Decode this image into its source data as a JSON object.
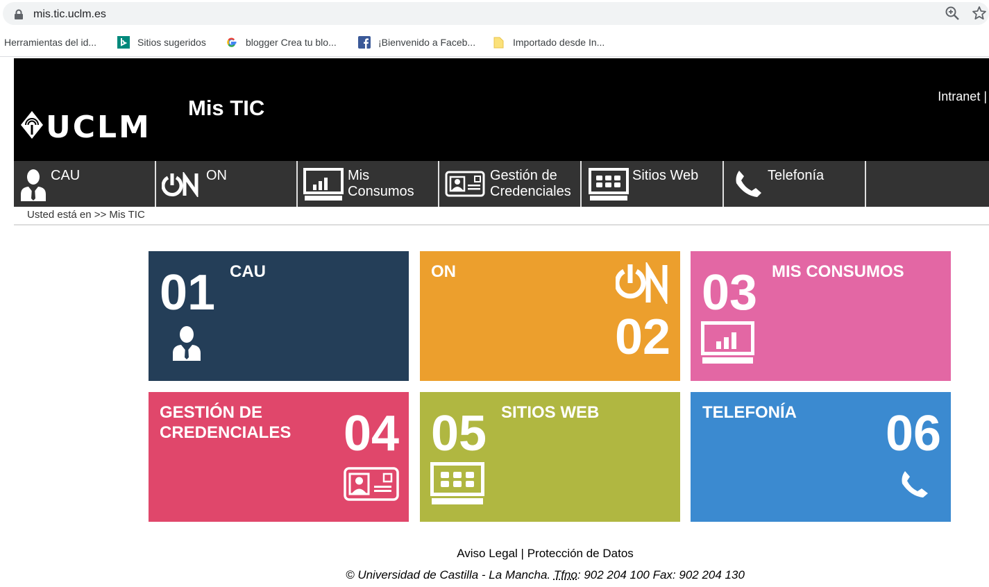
{
  "browser": {
    "url": "mis.tic.uclm.es",
    "bookmarks": [
      {
        "label": "Herramientas del id...",
        "icon": "none"
      },
      {
        "label": "Sitios sugeridos",
        "icon": "bing-icon"
      },
      {
        "label": "blogger Crea tu blo...",
        "icon": "google-icon"
      },
      {
        "label": "¡Bienvenido a Faceb...",
        "icon": "facebook-icon"
      },
      {
        "label": "Importado desde In...",
        "icon": "folder-icon"
      }
    ]
  },
  "header": {
    "logo_text": "UCLM",
    "title": "Mis TIC",
    "intranet": "Intranet |"
  },
  "nav": [
    {
      "line1": "CAU",
      "line2": "",
      "icon": "user-icon"
    },
    {
      "line1": "ON",
      "line2": "",
      "icon": "on-logo-icon"
    },
    {
      "line1": "Mis",
      "line2": "Consumos",
      "icon": "chart-monitor-icon"
    },
    {
      "line1": "Gestión de",
      "line2": "Credenciales",
      "icon": "id-card-icon"
    },
    {
      "line1": "Sitios Web",
      "line2": "",
      "icon": "web-grid-icon"
    },
    {
      "line1": "Telefonía",
      "line2": "",
      "icon": "phone-icon"
    }
  ],
  "breadcrumb": "Usted está en >> Mis TIC",
  "tiles": [
    {
      "num": "01",
      "title": "CAU",
      "color": "#243e58"
    },
    {
      "num": "02",
      "title": "ON",
      "color": "#ec9f2d"
    },
    {
      "num": "03",
      "title": "MIS CONSUMOS",
      "color": "#e367a4"
    },
    {
      "num": "04",
      "title_line1": "GESTIÓN DE",
      "title_line2": "CREDENCIALES",
      "color": "#e0476b"
    },
    {
      "num": "05",
      "title": "SITIOS WEB",
      "color": "#b0b741"
    },
    {
      "num": "06",
      "title": "TELEFONÍA",
      "color": "#3b8ad0"
    }
  ],
  "footer": {
    "aviso": "Aviso Legal",
    "sep": " | ",
    "proteccion": "Protección de Datos",
    "copy_prefix": "© Universidad de Castilla - La Mancha. ",
    "tfno": "Tfno",
    "copy_suffix": ": 902 204 100 Fax: 902 204 130"
  }
}
